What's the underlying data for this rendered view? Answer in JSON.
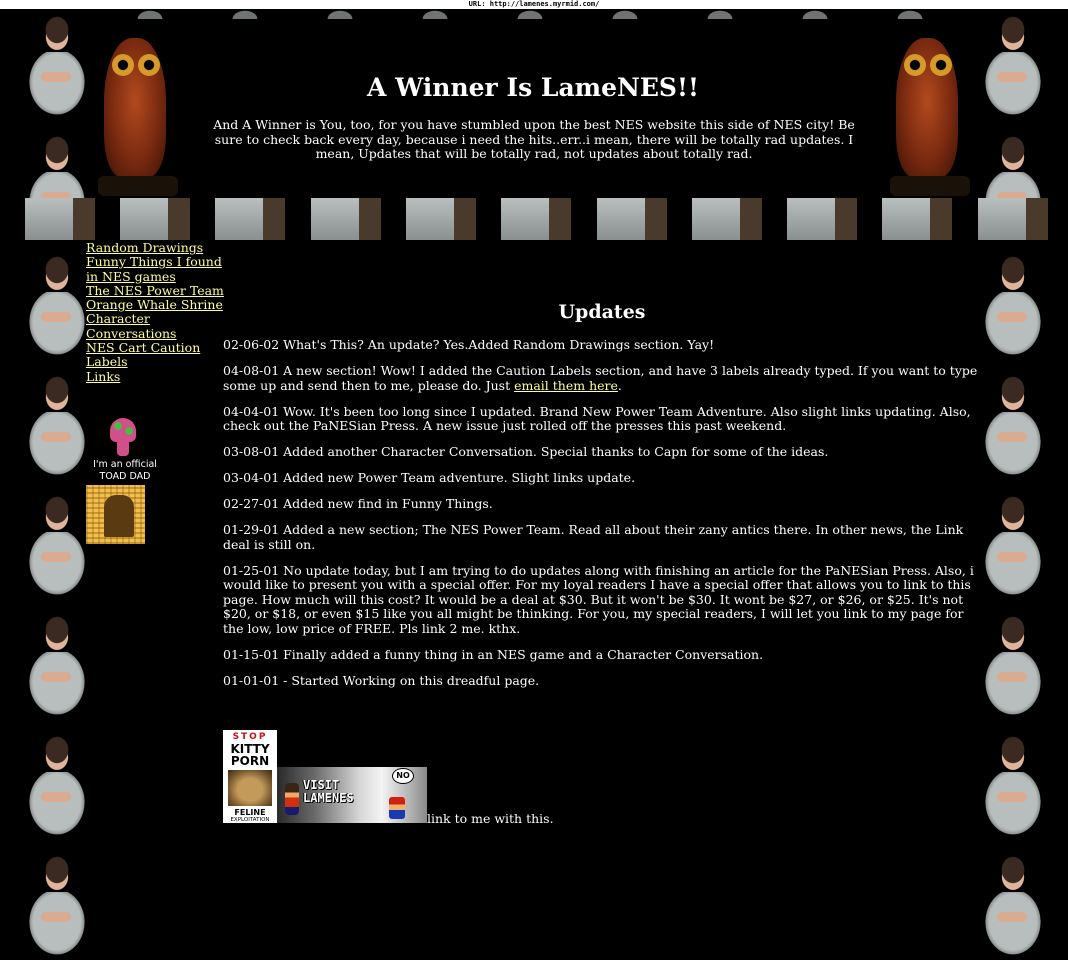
{
  "browser": {
    "url_label": "URL: http://lamenes.myrmid.com/"
  },
  "header": {
    "title": "A Winner Is LameNES!!",
    "intro": "And A Winner is You, too, for you have stumbled upon the best NES website this side of NES city! Be sure to check back every day, because i need the hits..err..i mean, there will be totally rad updates. I mean, Updates that will be totally rad, not updates about totally rad."
  },
  "nav": {
    "items": [
      {
        "label": "Random Drawings"
      },
      {
        "label": "Funny Things I found in NES games"
      },
      {
        "label": "The NES Power Team"
      },
      {
        "label": "Orange Whale Shrine"
      },
      {
        "label": "Character Conversations"
      },
      {
        "label": "NES Cart Caution Labels"
      },
      {
        "label": "Links"
      }
    ],
    "link_color": "#ffff99"
  },
  "badges": {
    "toad_line1": "I'm an official",
    "toad_line2": "TOAD DAD"
  },
  "updates": {
    "title": "Updates",
    "entries": [
      {
        "text": "02-06-02 What's This? An update? Yes.Added Random Drawings section. Yay!"
      },
      {
        "text": "04-08-01 A new section! Wow! I added the Caution Labels section, and have 3 labels already typed. If you want to type some up and send then to me, please do. Just ",
        "link": "email them here",
        "after": "."
      },
      {
        "text": "04-04-01 Wow. It's been too long since I updated. Brand New Power Team Adventure. Also slight links updating. Also, check out the PaNESian Press. A new issue just rolled off the presses this past weekend."
      },
      {
        "text": "03-08-01 Added another Character Conversation. Special thanks to Capn for some of the ideas."
      },
      {
        "text": "03-04-01 Added new Power Team adventure. Slight links update."
      },
      {
        "text": "02-27-01 Added new find in Funny Things."
      },
      {
        "text": "01-29-01 Added a new section; The NES Power Team. Read all about their zany antics there. In other news, the Link deal is still on."
      },
      {
        "text": "01-25-01 No update today, but I am trying to do updates along with finishing an article for the PaNESian Press. Also, i would like to present you with a special offer. For my loyal readers I have a special offer that allows you to link to this page. How much will this cost? It would be a deal at $30. But it won't be $30. It wont be $27, or $26, or $25. It's not $20, or $18, or even $15 like you all might be thinking. For you, my special readers, I will let you link to my page for the low, low price of FREE. Pls link 2 me. kthx."
      },
      {
        "text": "01-15-01 Finally added a funny thing in an NES game and a Character Conversation."
      },
      {
        "text": "01-01-01 - Started Working on this dreadful page."
      }
    ]
  },
  "footer": {
    "kitty": {
      "line1": "STOP",
      "line2": "KITTY",
      "line3": "PORN",
      "line4": "FELINE",
      "line5": "EXPLOITATION"
    },
    "visit_banner": {
      "text": "VISIT LAMENES",
      "bubble": "NO"
    },
    "link_text": "link to me with this."
  }
}
